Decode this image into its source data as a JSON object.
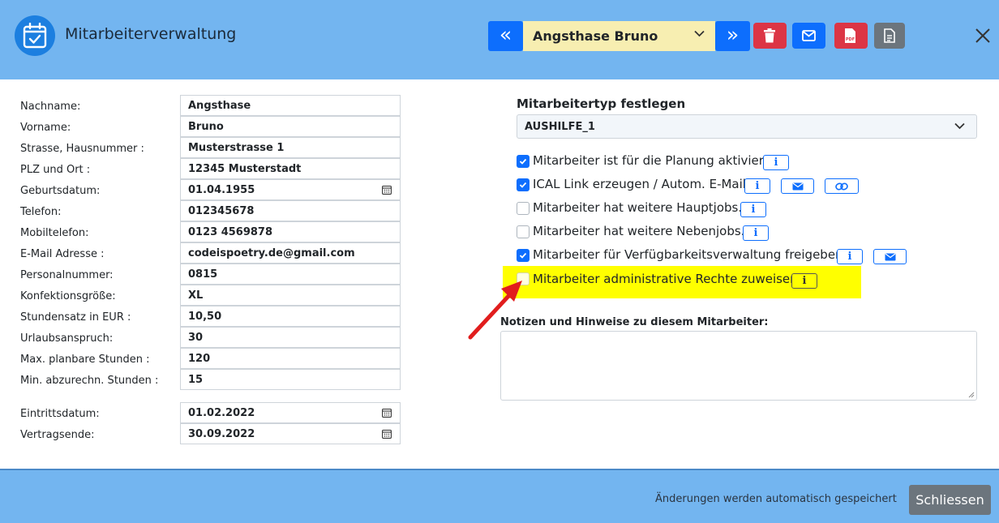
{
  "header": {
    "title": "Mitarbeiterverwaltung",
    "app_icon": "calendar-check-icon",
    "selected_employee": "Angsthase Bruno",
    "prev_icon": "double-chevron-left-icon",
    "next_icon": "double-chevron-right-icon",
    "actions": [
      {
        "name": "delete",
        "icon": "trash-icon",
        "color": "#dc3545"
      },
      {
        "name": "email",
        "icon": "envelope-icon",
        "color": "#0d6efd"
      },
      {
        "name": "pdf",
        "icon": "pdf-icon",
        "color": "#dc3545"
      },
      {
        "name": "document",
        "icon": "document-icon",
        "color": "#6c757d"
      }
    ],
    "close_icon": "close-icon"
  },
  "form": {
    "fields": [
      {
        "label": "Nachname:",
        "value": "Angsthase"
      },
      {
        "label": "Vorname:",
        "value": "Bruno"
      },
      {
        "label": "Strasse, Hausnummer :",
        "value": "Musterstrasse 1"
      },
      {
        "label": "PLZ und Ort :",
        "value": "12345 Musterstadt"
      },
      {
        "label": "Geburtsdatum:",
        "value": "01.04.1955"
      },
      {
        "label": "Telefon:",
        "value": "012345678"
      },
      {
        "label": "Mobiltelefon:",
        "value": "0123 4569878"
      },
      {
        "label": "E-Mail Adresse :",
        "value": "codeispoetry.de@gmail.com"
      },
      {
        "label": "Personalnummer:",
        "value": "0815"
      },
      {
        "label": "Konfektionsgröße:",
        "value": "XL"
      },
      {
        "label": "Stundensatz in EUR :",
        "value": "10,50"
      },
      {
        "label": "Urlaubsanspruch:",
        "value": "30"
      },
      {
        "label": "Max. planbare Stunden :",
        "value": "120"
      },
      {
        "label": "Min. abzurechn. Stunden :",
        "value": "15"
      }
    ],
    "contract": [
      {
        "label": "Eintrittsdatum:",
        "value": "01.02.2022"
      },
      {
        "label": "Vertragsende:",
        "value": "30.09.2022"
      }
    ]
  },
  "right": {
    "type_label": "Mitarbeitertyp festlegen",
    "type_value": "AUSHILFE_1",
    "options": [
      {
        "label": "Mitarbeiter ist für die Planung aktiviert",
        "checked": true,
        "buttons": [
          "info"
        ]
      },
      {
        "label": "ICAL Link erzeugen / Autom. E-Mail",
        "checked": true,
        "buttons": [
          "info",
          "envelope",
          "link"
        ]
      },
      {
        "label": "Mitarbeiter hat weitere Hauptjobs.",
        "checked": false,
        "buttons": [
          "info"
        ]
      },
      {
        "label": "Mitarbeiter hat weitere Nebenjobs.",
        "checked": false,
        "buttons": [
          "info"
        ]
      },
      {
        "label": "Mitarbeiter für Verfügbarkeitsverwaltung freigeben",
        "checked": true,
        "buttons": [
          "info",
          "envelope"
        ]
      },
      {
        "label": "Mitarbeiter administrative Rechte zuweisen",
        "checked": false,
        "buttons": [
          "info"
        ],
        "highlighted": true
      }
    ],
    "info_glyph": "i",
    "notes_label": "Notizen und Hinweise zu diesem Mitarbeiter:",
    "notes_value": ""
  },
  "footer": {
    "save_note": "Änderungen werden automatisch gespeichert",
    "close_label": "Schliessen"
  },
  "colors": {
    "header_bg": "#73b5f0",
    "primary": "#0d6efd",
    "danger": "#dc3545",
    "highlight": "#ffff00",
    "select_bg": "#f7eeb1"
  }
}
